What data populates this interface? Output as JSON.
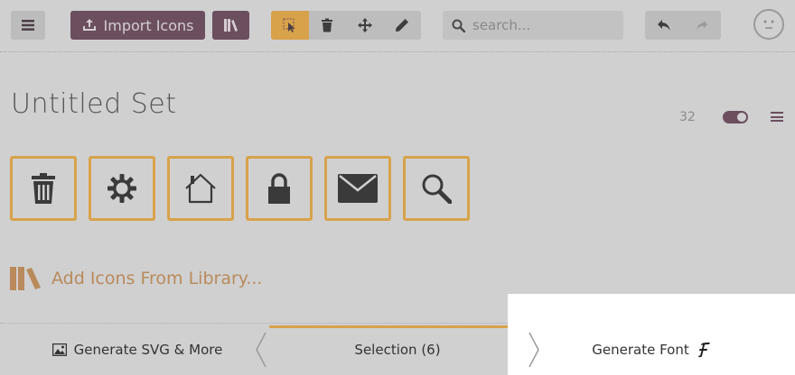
{
  "toolbar": {
    "import_label": "Import Icons",
    "search_placeholder": "search..."
  },
  "set": {
    "title": "Untitled Set",
    "icon_size": "32"
  },
  "icons": [
    "trash",
    "gear",
    "home",
    "lock",
    "envelope",
    "search"
  ],
  "add_library_label": "Add Icons From Library...",
  "bottom": {
    "svg_label": "Generate SVG & More",
    "selection_label": "Selection (6)",
    "font_label": "Generate Font"
  },
  "colors": {
    "accent": "#d8a24a",
    "brand": "#6b4f5f",
    "library_text": "#b98a5c"
  }
}
